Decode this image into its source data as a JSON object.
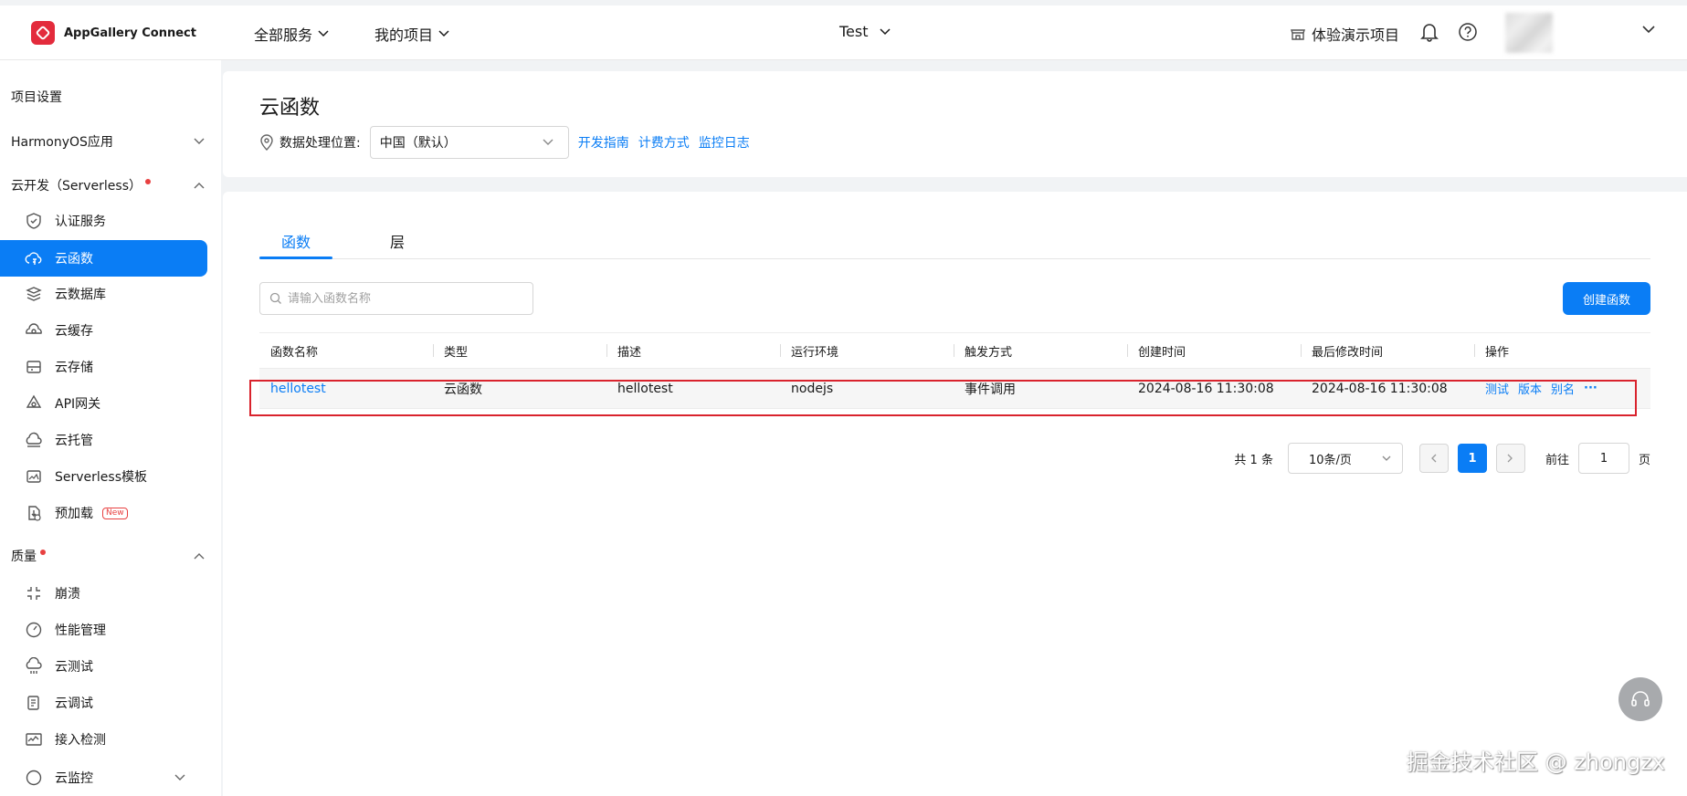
{
  "topbar": {
    "brand": "AppGallery Connect",
    "all_services": "全部服务",
    "my_projects": "我的项目",
    "project_name": "Test",
    "demo_project": "体验演示项目"
  },
  "sidebar": {
    "project_settings": "项目设置",
    "harmony_group": "HarmonyOS应用",
    "serverless_group": "云开发（Serverless）",
    "serverless_items": [
      {
        "label": "认证服务",
        "icon": "shield-icon"
      },
      {
        "label": "云函数",
        "icon": "cloud-function-icon"
      },
      {
        "label": "云数据库",
        "icon": "database-icon"
      },
      {
        "label": "云缓存",
        "icon": "cache-icon"
      },
      {
        "label": "云存储",
        "icon": "storage-icon"
      },
      {
        "label": "API网关",
        "icon": "api-gateway-icon"
      },
      {
        "label": "云托管",
        "icon": "hosting-icon"
      },
      {
        "label": "Serverless模板",
        "icon": "template-icon"
      },
      {
        "label": "预加载",
        "icon": "preload-icon",
        "badge": "New"
      }
    ],
    "quality_group": "质量",
    "quality_items": [
      {
        "label": "崩溃",
        "icon": "crash-icon"
      },
      {
        "label": "性能管理",
        "icon": "gauge-icon"
      },
      {
        "label": "云测试",
        "icon": "cloud-test-icon"
      },
      {
        "label": "云调试",
        "icon": "cloud-debug-icon"
      },
      {
        "label": "接入检测",
        "icon": "monitor-icon"
      },
      {
        "label": "云监控",
        "icon": "cloud-monitor-icon"
      }
    ]
  },
  "header": {
    "title": "云函数",
    "location_label": "数据处理位置:",
    "location_value": "中国（默认）",
    "links": [
      "开发指南",
      "计费方式",
      "监控日志"
    ]
  },
  "tabs": [
    "函数",
    "层"
  ],
  "search": {
    "placeholder": "请输入函数名称"
  },
  "create_button": "创建函数",
  "table": {
    "columns": [
      "函数名称",
      "类型",
      "描述",
      "运行环境",
      "触发方式",
      "创建时间",
      "最后修改时间",
      "操作"
    ],
    "rows": [
      {
        "name": "hellotest",
        "type": "云函数",
        "description": "hellotest",
        "runtime": "nodejs",
        "trigger": "事件调用",
        "created": "2024-08-16 11:30:08",
        "modified": "2024-08-16 11:30:08",
        "actions": [
          "测试",
          "版本",
          "别名",
          "···"
        ]
      }
    ]
  },
  "pagination": {
    "total": "共 1 条",
    "page_size": "10条/页",
    "current": "1",
    "goto_label": "前往",
    "goto_value": "1",
    "page_suffix": "页"
  },
  "watermark": "掘金技术社区 @ zhongzx",
  "colors": {
    "accent": "#0a7df5",
    "brand": "#e32b3c",
    "highlight": "#d9232d"
  }
}
